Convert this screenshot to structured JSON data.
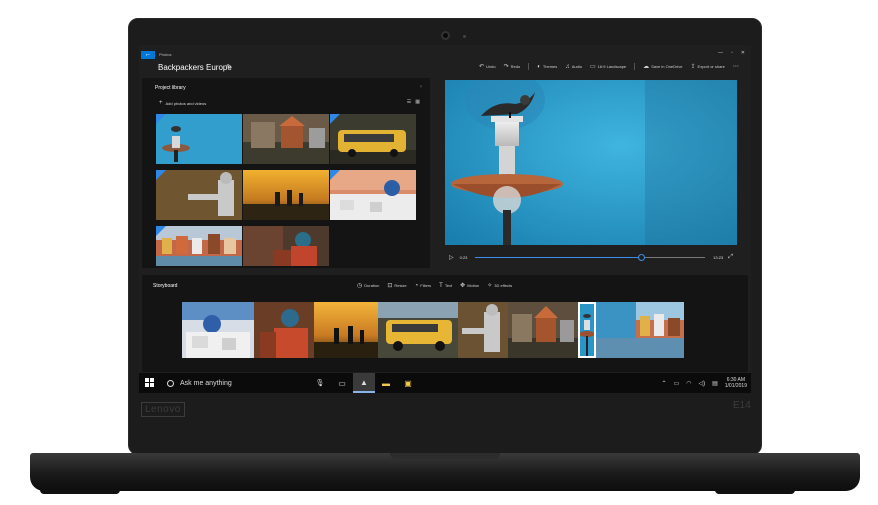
{
  "device": {
    "brand": "Lenovo",
    "model": "E14"
  },
  "app": {
    "name": "Photos",
    "back_label": "←",
    "project_title": "Backpackers Europe",
    "window_controls": [
      "—",
      "▫",
      "✕"
    ],
    "toolbar": {
      "undo": "Undo",
      "redo": "Redo",
      "themes": "Themes",
      "audio": "Audio",
      "aspect": "16:9 Landscape",
      "onedrive": "Save in OneDrive",
      "export": "Export or share",
      "more": "⋯"
    }
  },
  "library": {
    "title": "Project library",
    "add_label": "Add photos and videos"
  },
  "player": {
    "current_time": "0:23",
    "end_time": "13:23",
    "progress": 0.72
  },
  "storyboard": {
    "title": "Storyboard",
    "tools": {
      "duration": "Duration",
      "resize": "Resize",
      "filters": "Filters",
      "text": "Text",
      "motion": "Motion",
      "effects": "3D effects"
    }
  },
  "taskbar": {
    "search_placeholder": "Ask me anything",
    "time": "6:30 AM",
    "date": "1/01/2019"
  },
  "colors": {
    "accent": "#0078d7",
    "sky_blue": "#2f9fd0",
    "panel_bg": "#141414",
    "app_bg": "#1f1f1f"
  }
}
